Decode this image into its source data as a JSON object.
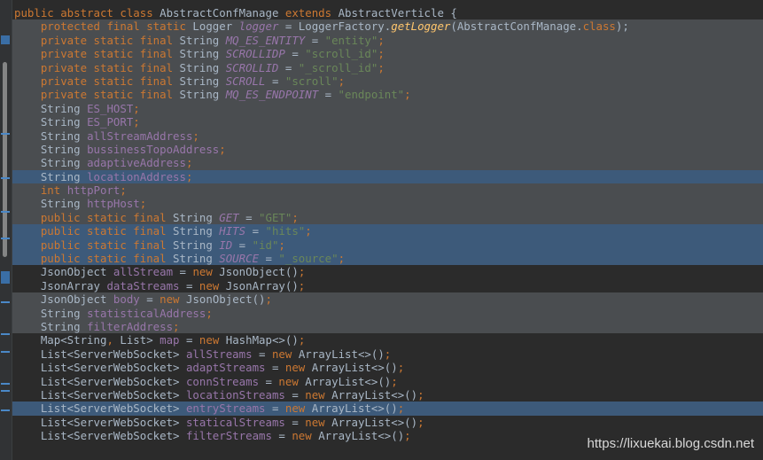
{
  "editor": {
    "lines": [
      {
        "id": "l0",
        "bg": "none",
        "parts": [
          [
            "k",
            "public abstract class "
          ],
          [
            "c",
            "AbstractConfManage "
          ],
          [
            "k",
            "extends "
          ],
          [
            "c",
            "AbstractVerticle {"
          ]
        ]
      },
      {
        "id": "l1",
        "bg": "sel",
        "parts": [
          [
            "c",
            "    "
          ],
          [
            "k",
            "protected final static "
          ],
          [
            "c",
            "Logger "
          ],
          [
            "sf",
            "logger"
          ],
          [
            "c",
            " = LoggerFactory."
          ],
          [
            "m",
            "getLogger"
          ],
          [
            "c",
            "(AbstractConfManage."
          ],
          [
            "k",
            "class"
          ],
          [
            "c",
            ");"
          ]
        ]
      },
      {
        "id": "l2",
        "bg": "sel",
        "parts": [
          [
            "c",
            "    "
          ],
          [
            "k",
            "private static final "
          ],
          [
            "c",
            "String "
          ],
          [
            "sf",
            "MQ_ES_ENTITY"
          ],
          [
            "c",
            " = "
          ],
          [
            "s",
            "\"entity\""
          ],
          [
            "k",
            ";"
          ]
        ]
      },
      {
        "id": "l3",
        "bg": "sel",
        "parts": [
          [
            "c",
            "    "
          ],
          [
            "k",
            "private static final "
          ],
          [
            "c",
            "String "
          ],
          [
            "sf",
            "SCROLLIDP"
          ],
          [
            "c",
            " = "
          ],
          [
            "s",
            "\"scroll_id\""
          ],
          [
            "k",
            ";"
          ]
        ]
      },
      {
        "id": "l4",
        "bg": "sel",
        "parts": [
          [
            "c",
            "    "
          ],
          [
            "k",
            "private static final "
          ],
          [
            "c",
            "String "
          ],
          [
            "sf",
            "SCROLLID"
          ],
          [
            "c",
            " = "
          ],
          [
            "s",
            "\"_scroll_id\""
          ],
          [
            "k",
            ";"
          ]
        ]
      },
      {
        "id": "l5",
        "bg": "sel",
        "parts": [
          [
            "c",
            "    "
          ],
          [
            "k",
            "private static final "
          ],
          [
            "c",
            "String "
          ],
          [
            "sf",
            "SCROLL"
          ],
          [
            "c",
            " = "
          ],
          [
            "s",
            "\"scroll\""
          ],
          [
            "k",
            ";"
          ]
        ]
      },
      {
        "id": "l6",
        "bg": "sel",
        "parts": [
          [
            "c",
            "    "
          ],
          [
            "k",
            "private static final "
          ],
          [
            "c",
            "String "
          ],
          [
            "sf",
            "MQ_ES_ENDPOINT"
          ],
          [
            "c",
            " = "
          ],
          [
            "s",
            "\"endpoint\""
          ],
          [
            "k",
            ";"
          ]
        ]
      },
      {
        "id": "l7",
        "bg": "sel",
        "parts": [
          [
            "c",
            "    String "
          ],
          [
            "f",
            "ES_HOST"
          ],
          [
            "k",
            ";"
          ]
        ]
      },
      {
        "id": "l8",
        "bg": "sel",
        "parts": [
          [
            "c",
            "    String "
          ],
          [
            "f",
            "ES_PORT"
          ],
          [
            "k",
            ";"
          ]
        ]
      },
      {
        "id": "l9",
        "bg": "sel",
        "parts": [
          [
            "c",
            "    String "
          ],
          [
            "f",
            "allStreamAddress"
          ],
          [
            "k",
            ";"
          ]
        ]
      },
      {
        "id": "l10",
        "bg": "sel",
        "parts": [
          [
            "c",
            "    String "
          ],
          [
            "f",
            "bussinessTopoAddress"
          ],
          [
            "k",
            ";"
          ]
        ]
      },
      {
        "id": "l11",
        "bg": "sel",
        "parts": [
          [
            "c",
            "    String "
          ],
          [
            "f",
            "adaptiveAddress"
          ],
          [
            "k",
            ";"
          ]
        ]
      },
      {
        "id": "l12",
        "bg": "hi",
        "parts": [
          [
            "c",
            "    String "
          ],
          [
            "f",
            "locationAddress"
          ],
          [
            "k",
            ";"
          ]
        ]
      },
      {
        "id": "l13",
        "bg": "sel",
        "parts": [
          [
            "c",
            "    "
          ],
          [
            "k",
            "int "
          ],
          [
            "f",
            "httpPort"
          ],
          [
            "k",
            ";"
          ]
        ]
      },
      {
        "id": "l14",
        "bg": "sel",
        "parts": [
          [
            "c",
            "    String "
          ],
          [
            "f",
            "httpHost"
          ],
          [
            "k",
            ";"
          ]
        ]
      },
      {
        "id": "l15",
        "bg": "sel",
        "parts": [
          [
            "c",
            "    "
          ],
          [
            "k",
            "public static final "
          ],
          [
            "c",
            "String "
          ],
          [
            "sf",
            "GET"
          ],
          [
            "c",
            " = "
          ],
          [
            "s",
            "\"GET\""
          ],
          [
            "k",
            ";"
          ]
        ]
      },
      {
        "id": "l16",
        "bg": "hi",
        "parts": [
          [
            "c",
            "    "
          ],
          [
            "k",
            "public static final "
          ],
          [
            "c",
            "String "
          ],
          [
            "sf",
            "HITS"
          ],
          [
            "c",
            " = "
          ],
          [
            "s",
            "\"hits\""
          ],
          [
            "k",
            ";"
          ]
        ]
      },
      {
        "id": "l17",
        "bg": "hi",
        "parts": [
          [
            "c",
            "    "
          ],
          [
            "k",
            "public static final "
          ],
          [
            "c",
            "String "
          ],
          [
            "sf",
            "ID"
          ],
          [
            "c",
            " = "
          ],
          [
            "s",
            "\"id\""
          ],
          [
            "k",
            ";"
          ]
        ]
      },
      {
        "id": "l18",
        "bg": "hi",
        "parts": [
          [
            "c",
            "    "
          ],
          [
            "k",
            "public static final "
          ],
          [
            "c",
            "String "
          ],
          [
            "sf",
            "SOURCE"
          ],
          [
            "c",
            " = "
          ],
          [
            "s",
            "\"_source\""
          ],
          [
            "k",
            ";"
          ]
        ]
      },
      {
        "id": "l19",
        "bg": "none",
        "parts": [
          [
            "c",
            "    JsonObject "
          ],
          [
            "f",
            "allStream"
          ],
          [
            "c",
            " = "
          ],
          [
            "k",
            "new "
          ],
          [
            "c",
            "JsonObject()"
          ],
          [
            "k",
            ";"
          ]
        ]
      },
      {
        "id": "l20",
        "bg": "none",
        "parts": [
          [
            "c",
            "    JsonArray "
          ],
          [
            "f",
            "dataStreams"
          ],
          [
            "c",
            " = "
          ],
          [
            "k",
            "new "
          ],
          [
            "c",
            "JsonArray()"
          ],
          [
            "k",
            ";"
          ]
        ]
      },
      {
        "id": "l21",
        "bg": "sel",
        "parts": [
          [
            "c",
            "    JsonObject "
          ],
          [
            "f",
            "body"
          ],
          [
            "c",
            " = "
          ],
          [
            "k",
            "new "
          ],
          [
            "c",
            "JsonObject()"
          ],
          [
            "k",
            ";"
          ]
        ]
      },
      {
        "id": "l22",
        "bg": "sel",
        "parts": [
          [
            "c",
            "    String "
          ],
          [
            "f",
            "statisticalAddress"
          ],
          [
            "k",
            ";"
          ]
        ]
      },
      {
        "id": "l23",
        "bg": "sel",
        "parts": [
          [
            "c",
            "    String "
          ],
          [
            "f",
            "filterAddress"
          ],
          [
            "k",
            ";"
          ]
        ]
      },
      {
        "id": "l24",
        "bg": "none",
        "parts": [
          [
            "c",
            "    Map<String"
          ],
          [
            "k",
            ", "
          ],
          [
            "c",
            "List> "
          ],
          [
            "f",
            "map"
          ],
          [
            "c",
            " = "
          ],
          [
            "k",
            "new "
          ],
          [
            "c",
            "HashMap<>()"
          ],
          [
            "k",
            ";"
          ]
        ]
      },
      {
        "id": "l25",
        "bg": "none",
        "parts": [
          [
            "c",
            "    List<ServerWebSocket> "
          ],
          [
            "f",
            "allStreams"
          ],
          [
            "c",
            " = "
          ],
          [
            "k",
            "new "
          ],
          [
            "c",
            "ArrayList<>()"
          ],
          [
            "k",
            ";"
          ]
        ]
      },
      {
        "id": "l26",
        "bg": "none",
        "parts": [
          [
            "c",
            "    List<ServerWebSocket> "
          ],
          [
            "f",
            "adaptStreams"
          ],
          [
            "c",
            " = "
          ],
          [
            "k",
            "new "
          ],
          [
            "c",
            "ArrayList<>()"
          ],
          [
            "k",
            ";"
          ]
        ]
      },
      {
        "id": "l27",
        "bg": "none",
        "parts": [
          [
            "c",
            "    List<ServerWebSocket> "
          ],
          [
            "f",
            "connStreams"
          ],
          [
            "c",
            " = "
          ],
          [
            "k",
            "new "
          ],
          [
            "c",
            "ArrayList<>()"
          ],
          [
            "k",
            ";"
          ]
        ]
      },
      {
        "id": "l28",
        "bg": "none",
        "parts": [
          [
            "c",
            "    List<ServerWebSocket> "
          ],
          [
            "f",
            "locationStreams"
          ],
          [
            "c",
            " = "
          ],
          [
            "k",
            "new "
          ],
          [
            "c",
            "ArrayList<>()"
          ],
          [
            "k",
            ";"
          ]
        ]
      },
      {
        "id": "l29",
        "bg": "hi",
        "parts": [
          [
            "c",
            "    List<ServerWebSocket> "
          ],
          [
            "f",
            "entryStreams"
          ],
          [
            "c",
            " = "
          ],
          [
            "k",
            "new "
          ],
          [
            "c",
            "ArrayList<>()"
          ],
          [
            "k",
            ";"
          ]
        ]
      },
      {
        "id": "l30",
        "bg": "none",
        "parts": [
          [
            "c",
            "    List<ServerWebSocket> "
          ],
          [
            "f",
            "staticalStreams"
          ],
          [
            "c",
            " = "
          ],
          [
            "k",
            "new "
          ],
          [
            "c",
            "ArrayList<>()"
          ],
          [
            "k",
            ";"
          ]
        ]
      },
      {
        "id": "l31",
        "bg": "none",
        "parts": [
          [
            "c",
            "    List<ServerWebSocket> "
          ],
          [
            "f",
            "filterStreams"
          ],
          [
            "c",
            " = "
          ],
          [
            "k",
            "new "
          ],
          [
            "c",
            "ArrayList<>()"
          ],
          [
            "k",
            ";"
          ]
        ]
      }
    ]
  },
  "watermark": "https://lixuekai.blog.csdn.net"
}
